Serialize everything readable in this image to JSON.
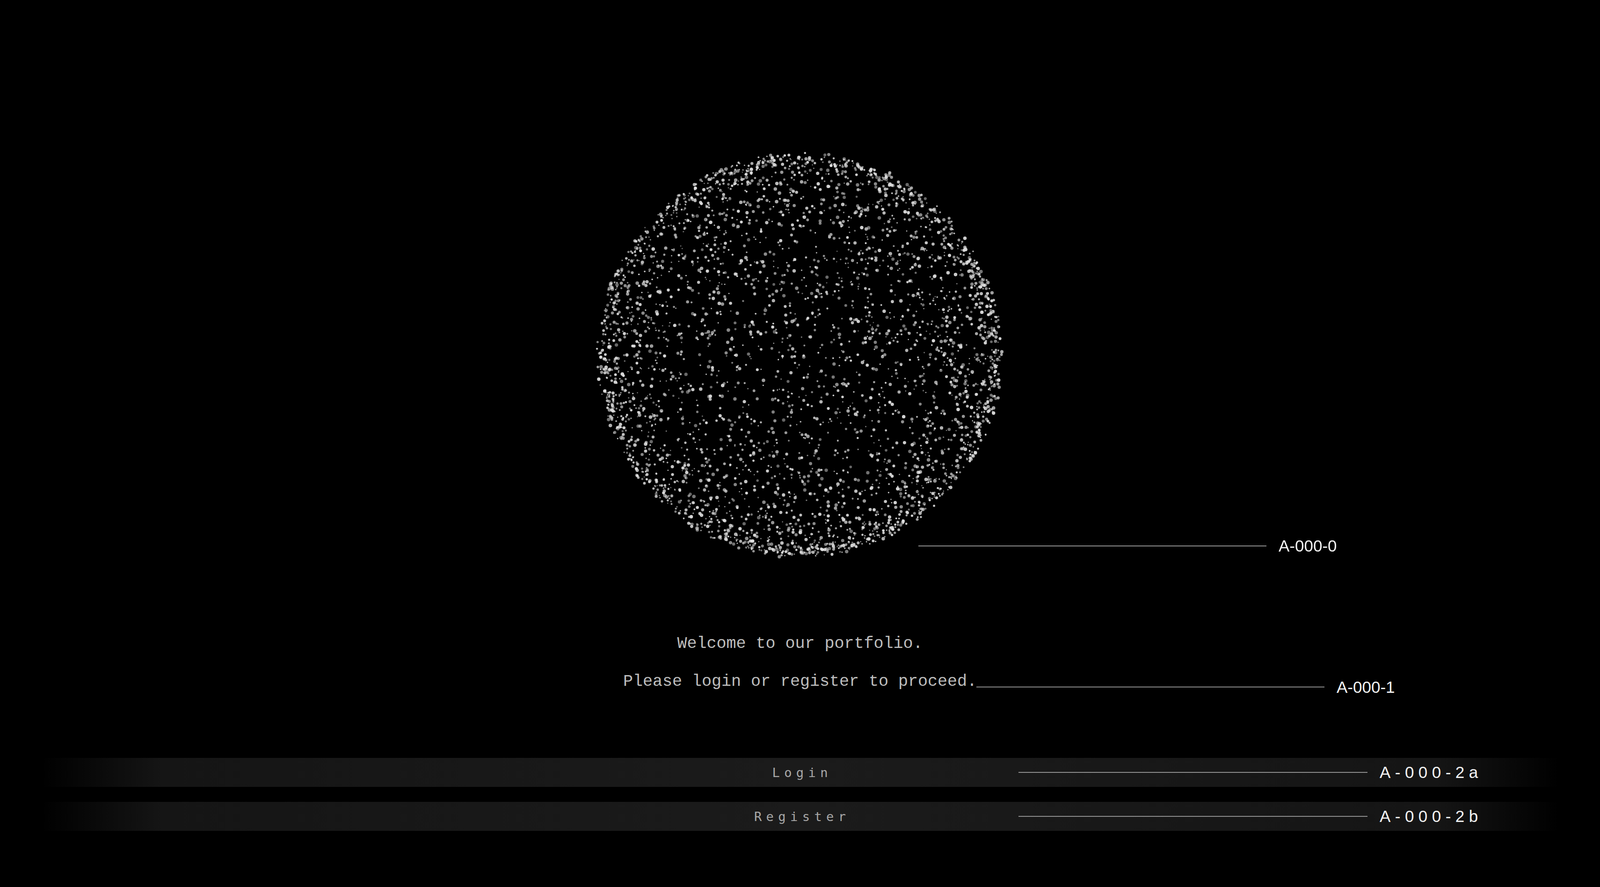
{
  "sphere": {
    "label": "A-000-0"
  },
  "intro": {
    "lines": [
      "Welcome to our portfolio.",
      "Please login or register to proceed."
    ],
    "label": "A-000-1"
  },
  "buttons": [
    {
      "label": "Login",
      "tag": "A-000-2a"
    },
    {
      "label": "Register",
      "tag": "A-000-2b"
    }
  ]
}
